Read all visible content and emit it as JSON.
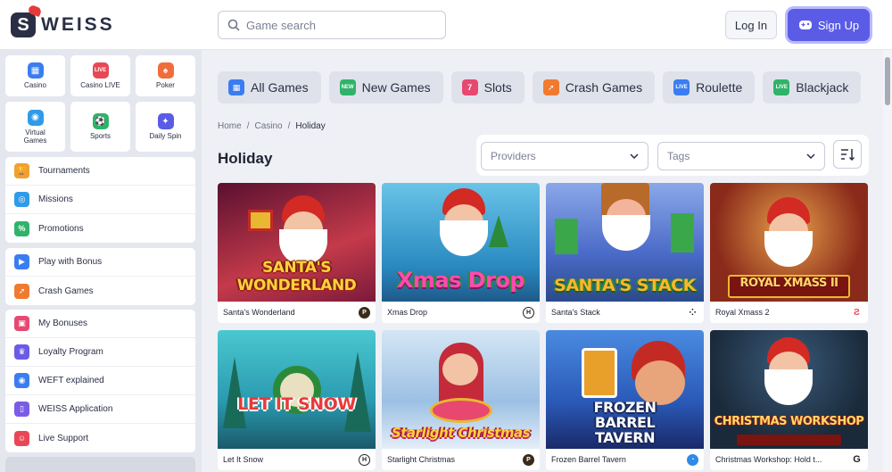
{
  "header": {
    "logo_text": "WEISS",
    "search_placeholder": "Game search",
    "login_label": "Log In",
    "signup_label": "Sign Up"
  },
  "sidebar": {
    "tiles": [
      {
        "label": "Casino",
        "icon": "casino-icon",
        "color": "#3b7df0"
      },
      {
        "label": "Casino LIVE",
        "icon": "live-icon",
        "color": "#e84855"
      },
      {
        "label": "Poker",
        "icon": "poker-icon",
        "color": "#f06d3b"
      },
      {
        "label": "Virtual Games",
        "icon": "virtual-games-icon",
        "color": "#2f9be8"
      },
      {
        "label": "Sports",
        "icon": "sports-icon",
        "color": "#2fb36a"
      },
      {
        "label": "Daily Spin",
        "icon": "daily-spin-icon",
        "color": "#5a5ce6"
      }
    ],
    "group1": [
      {
        "label": "Tournaments",
        "icon": "trophy-icon",
        "color": "#f0a030"
      },
      {
        "label": "Missions",
        "icon": "target-icon",
        "color": "#2f9be8"
      },
      {
        "label": "Promotions",
        "icon": "percent-icon",
        "color": "#2fb36a"
      }
    ],
    "group2": [
      {
        "label": "Play with Bonus",
        "icon": "bonus-play-icon",
        "color": "#3b7df0"
      },
      {
        "label": "Crash Games",
        "icon": "rocket-icon",
        "color": "#f07a30"
      }
    ],
    "group3": [
      {
        "label": "My Bonuses",
        "icon": "gift-icon",
        "color": "#e84870"
      },
      {
        "label": "Loyalty Program",
        "icon": "loyalty-icon",
        "color": "#6a5ce6"
      },
      {
        "label": "WEFT explained",
        "icon": "coin-icon",
        "color": "#3b7df0"
      },
      {
        "label": "WEISS Application",
        "icon": "app-icon",
        "color": "#7a5ce6"
      },
      {
        "label": "Live Support",
        "icon": "support-icon",
        "color": "#e84855"
      }
    ]
  },
  "categories": [
    {
      "label": "All Games",
      "icon": "all-games-icon",
      "color": "#3b7df0"
    },
    {
      "label": "New Games",
      "icon": "new-games-icon",
      "color": "#2fb36a"
    },
    {
      "label": "Slots",
      "icon": "slots-icon",
      "color": "#e84870"
    },
    {
      "label": "Crash Games",
      "icon": "rocket-icon",
      "color": "#f07a30"
    },
    {
      "label": "Roulette",
      "icon": "roulette-icon",
      "color": "#3b7df0"
    },
    {
      "label": "Blackjack",
      "icon": "blackjack-icon",
      "color": "#2fb36a"
    }
  ],
  "breadcrumb": [
    "Home",
    "Casino",
    "Holiday"
  ],
  "page_title": "Holiday",
  "filters": {
    "providers_placeholder": "Providers",
    "tags_placeholder": "Tags"
  },
  "games": [
    {
      "name": "Santa's Wonderland",
      "art": "SANTA'S WONDERLAND",
      "bg": "#7a1a3a",
      "bg2": "#c43a4a",
      "provider_color": "#3a2a1a"
    },
    {
      "name": "Xmas Drop",
      "art": "Xmas Drop",
      "bg": "#3aa0c8",
      "bg2": "#1e6a9a",
      "provider_color": "#222222"
    },
    {
      "name": "Santa's Stack",
      "art": "SANTA'S STACK",
      "bg": "#4a7ac8",
      "bg2": "#2a4a8a",
      "provider_color": "#111111"
    },
    {
      "name": "Royal Xmass 2",
      "art": "ROYAL XMASS II",
      "bg": "#8a2a1a",
      "bg2": "#c86a2a",
      "provider_color": "#e84855"
    },
    {
      "name": "Let It Snow",
      "art": "LET IT SNOW",
      "bg": "#2ab0b8",
      "bg2": "#1a6a7a",
      "provider_color": "#222222"
    },
    {
      "name": "Starlight Christmas",
      "art": "Starlight Christmas",
      "bg": "#b8d4ec",
      "bg2": "#7aa4d0",
      "provider_color": "#3a2a1a"
    },
    {
      "name": "Frozen Barrel Tavern",
      "art": "FROZEN BARREL TAVERN",
      "bg": "#2a6ab8",
      "bg2": "#1a3a7a",
      "provider_color": "#2f8ae8"
    },
    {
      "name": "Christmas Workshop: Hold t...",
      "art": "CHRISTMAS WORKSHOP",
      "bg": "#1a3a5a",
      "bg2": "#4a2a3a",
      "provider_color": "#222222"
    }
  ]
}
